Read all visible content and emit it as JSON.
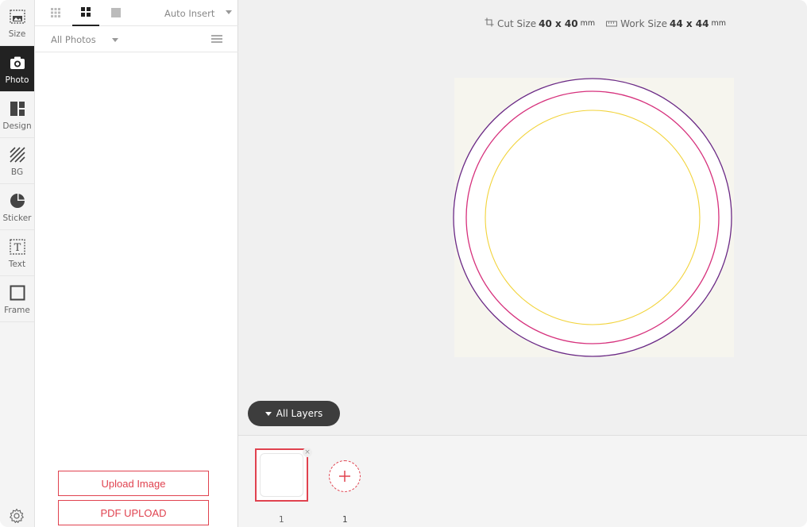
{
  "sidebar": {
    "items": [
      {
        "label": "Size",
        "icon": "size-icon"
      },
      {
        "label": "Photo",
        "icon": "camera-icon",
        "active": true
      },
      {
        "label": "Design",
        "icon": "layout-icon"
      },
      {
        "label": "BG",
        "icon": "pattern-icon"
      },
      {
        "label": "Sticker",
        "icon": "sticker-icon"
      },
      {
        "label": "Text",
        "icon": "text-icon"
      },
      {
        "label": "Frame",
        "icon": "frame-icon"
      }
    ],
    "settings_icon": "gear-icon"
  },
  "photo_panel": {
    "auto_insert": "Auto Insert",
    "filter": "All Photos",
    "upload_image": "Upload Image",
    "pdf_upload": "PDF UPLOAD"
  },
  "canvas": {
    "cut_size_label": "Cut Size",
    "cut_size_value": "40 x 40",
    "cut_size_unit": "mm",
    "work_size_label": "Work Size",
    "work_size_value": "44 x 44",
    "work_size_unit": "mm",
    "all_layers": "All Layers"
  },
  "pages": {
    "thumb_number": "1",
    "count": "1",
    "close": "×"
  },
  "colors": {
    "accent": "#e0424f",
    "outer_circle": "#6b2a86",
    "cut_circle": "#d6317c",
    "safe_circle": "#f2d33a"
  }
}
